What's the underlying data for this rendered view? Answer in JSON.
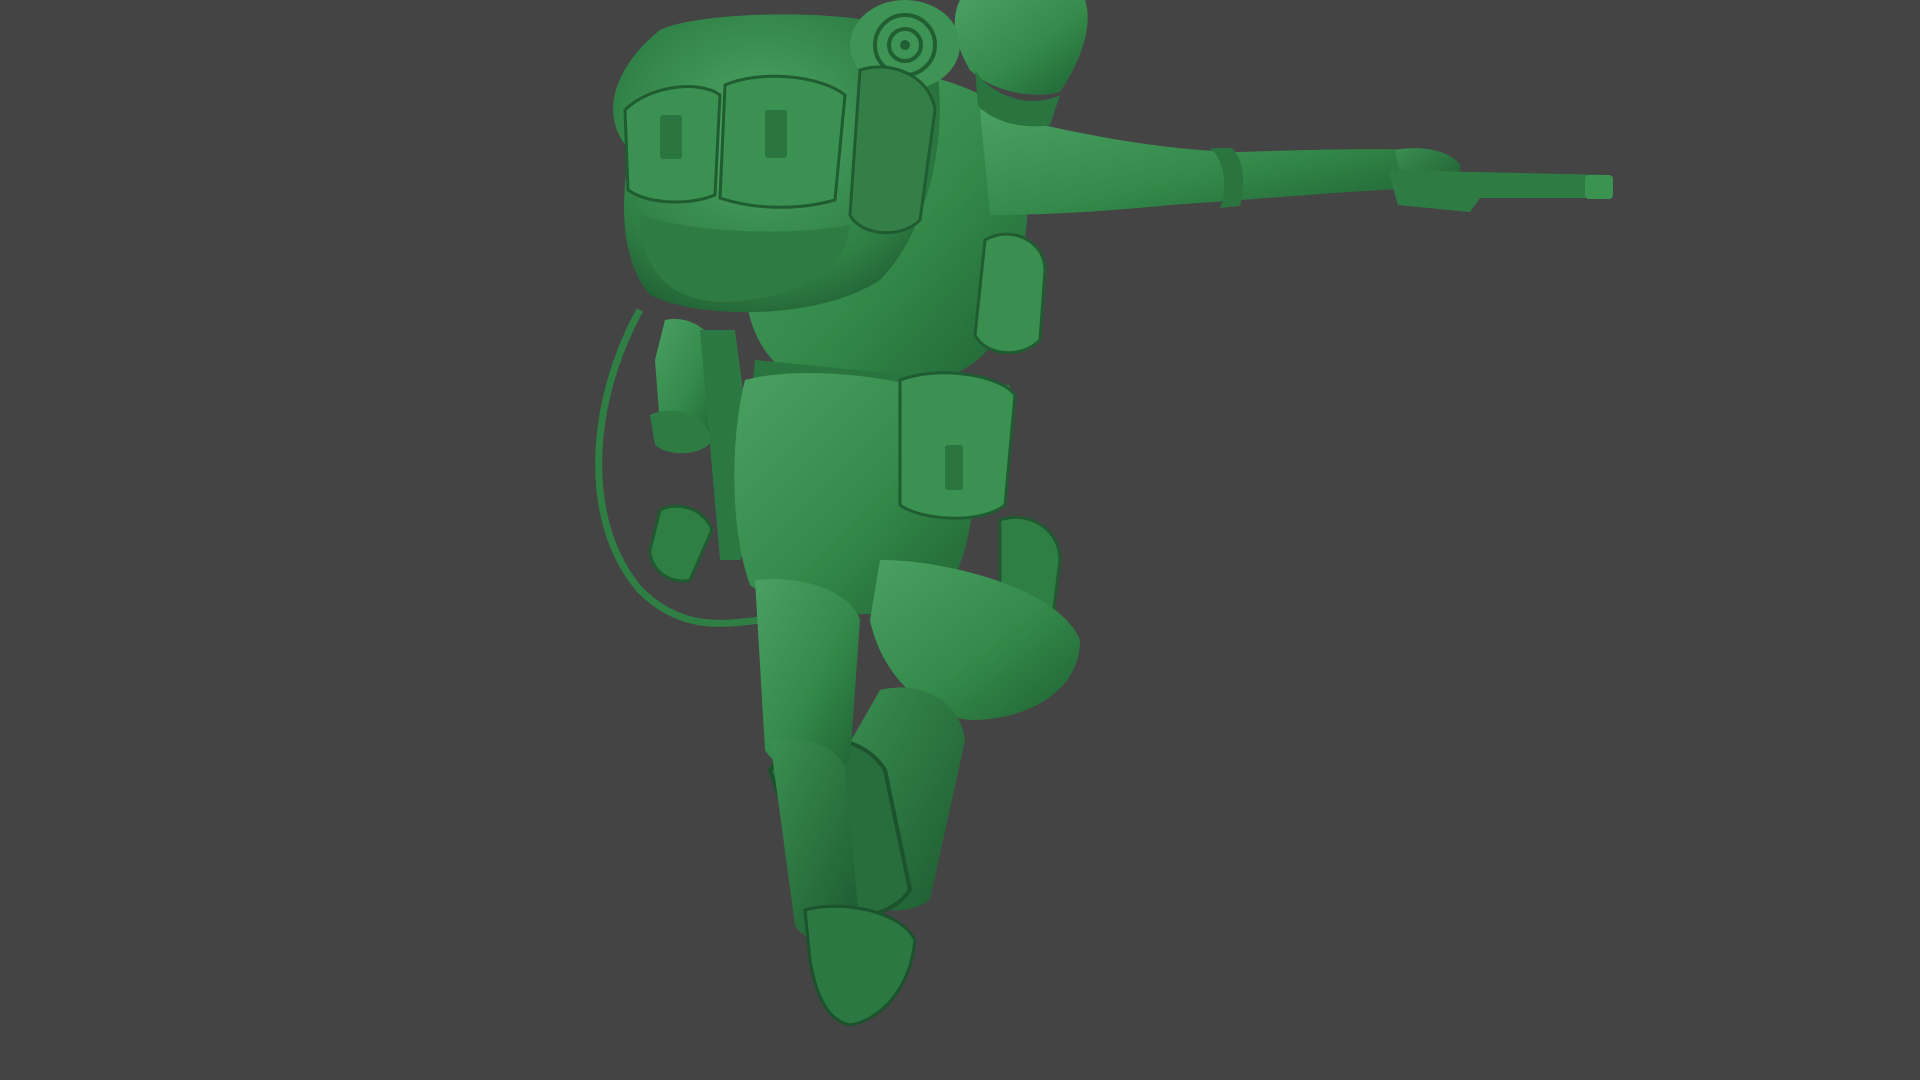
{
  "scene": {
    "background_color": "#444444",
    "subject": "green-plastic-army-soldier-sculpt",
    "material_color": "#3a8a4e",
    "shadow_color": "#1f5a30",
    "highlight_color": "#5cb070"
  }
}
